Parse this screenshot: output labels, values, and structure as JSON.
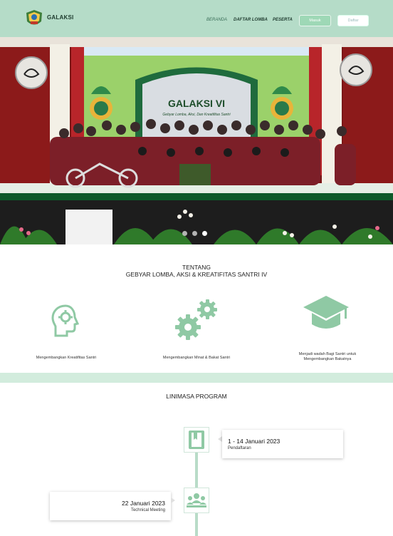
{
  "nav": {
    "brand": "GALAKSI",
    "links": [
      "BERANDA",
      "DAFTAR LOMBA",
      "PESERTA"
    ],
    "login_label": "Masuk",
    "register_label": "Daftar"
  },
  "hero": {
    "banner_title": "GALAKSI VI",
    "banner_subtitle": "Gebyar Lomba, Aksi, Dan Kreatifitas Santri",
    "slide_count": 3,
    "active_slide": 3
  },
  "about": {
    "heading_line1": "TENTANG",
    "heading_line2": "GEBYAR LOMBA, AKSI & KREATIFITAS SANTRI IV",
    "features": [
      {
        "icon": "head-gear-icon",
        "label": "Mengembangkan Kreatifitas Santri"
      },
      {
        "icon": "gears-icon",
        "label": "Mengembangkan Minat & Bakat Santri"
      },
      {
        "icon": "graduation-cap-icon",
        "label_line1": "Menjadi wadah Bagi Santri untuk",
        "label_line2": "Mengembangkan Bakatnya"
      }
    ]
  },
  "timeline": {
    "heading": "LINIMASA PROGRAM",
    "events": [
      {
        "date": "1 - 14  Januari 2023",
        "title": "Pendaftaran",
        "icon": "registration-book-icon"
      },
      {
        "date": "22  Januari 2023",
        "title": "Technical Meeting",
        "icon": "meeting-people-icon"
      }
    ]
  },
  "colors": {
    "nav_bg": "#b5dcc8",
    "accent_green": "#8fc9a4",
    "band": "#d2ecdd"
  }
}
